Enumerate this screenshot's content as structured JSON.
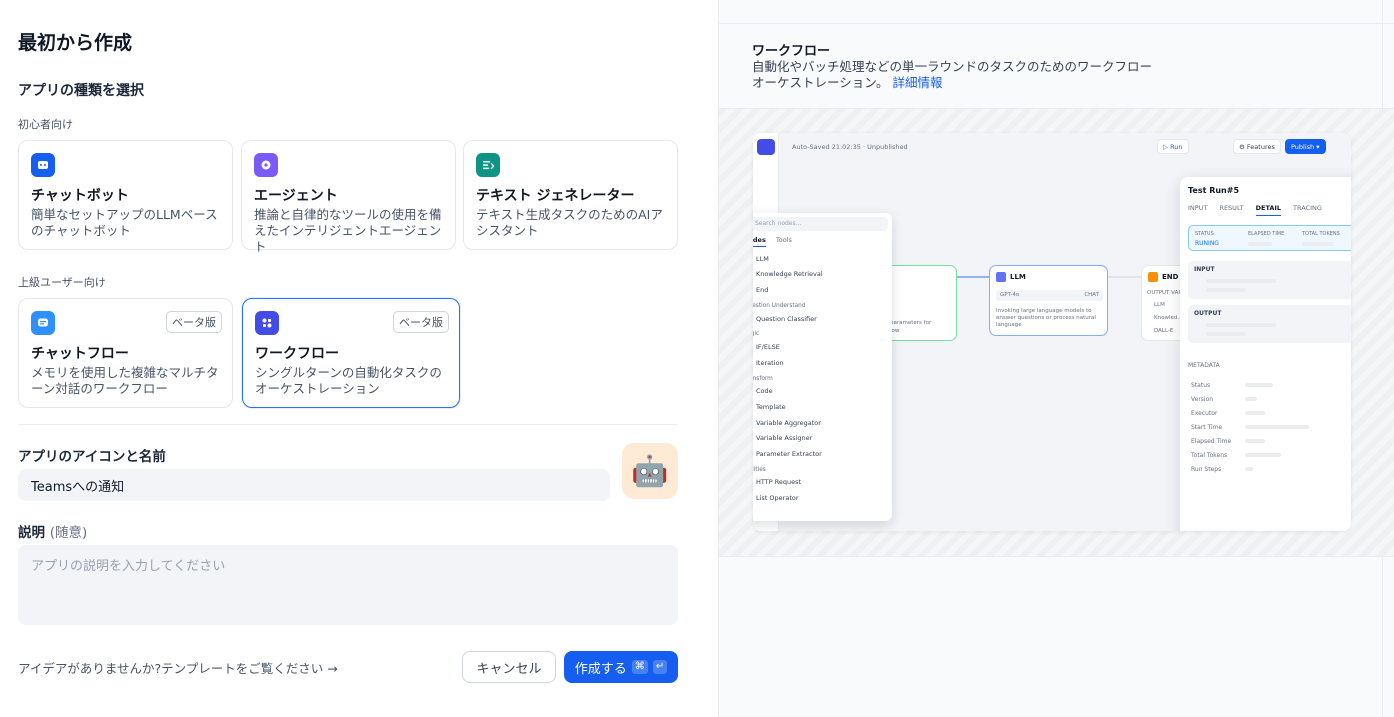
{
  "left": {
    "page_title": "最初から作成",
    "app_type_title": "アプリの種類を選択",
    "beginner_label": "初心者向け",
    "advanced_label": "上級ユーザー向け",
    "beginner_cards": [
      {
        "title": "チャットボット",
        "desc": "簡単なセットアップのLLMベースのチャットボット",
        "icon": "chatbot-icon",
        "color": "#155eef"
      },
      {
        "title": "エージェント",
        "desc": "推論と自律的なツールの使用を備えたインテリジェントエージェント",
        "icon": "agent-icon",
        "color": "#7a5af8"
      },
      {
        "title": "テキスト ジェネレーター",
        "desc": "テキスト生成タスクのためのAIアシスタント",
        "icon": "text-generator-icon",
        "color": "#0e9384"
      }
    ],
    "advanced_cards": [
      {
        "title": "チャットフロー",
        "desc": "メモリを使用した複雑なマルチターン対話のワークフロー",
        "icon": "chatflow-icon",
        "color": "#2e90fa",
        "badge": "ベータ版"
      },
      {
        "title": "ワークフロー",
        "desc": "シングルターンの自動化タスクのオーケストレーション",
        "icon": "workflow-icon",
        "color": "#444ce7",
        "badge": "ベータ版"
      }
    ],
    "name_label": "アプリのアイコンと名前",
    "name_value": "Teamsへの通知",
    "emoji": "🤖",
    "desc_label": "説明",
    "desc_optional": "(随意)",
    "desc_placeholder": "アプリの説明を入力してください",
    "template_link": "アイデアがありませんか?テンプレートをご覧ください →",
    "cancel_label": "キャンセル",
    "create_label": "作成する",
    "create_kbd1": "⌘",
    "create_kbd2": "↵"
  },
  "right": {
    "title": "ワークフロー",
    "desc": "自動化やバッチ処理などの単一ラウンドのタスクのためのワークフローオーケストレーション。",
    "more_link": "詳細情報",
    "preview": {
      "autosave": "Auto-Saved 21:02:35 · Unpublished",
      "run": "Run",
      "features": "Features",
      "publish": "Publish",
      "search_placeholder": "Search nodes...",
      "tabs": [
        "Nodes",
        "Tools"
      ],
      "nodes": [
        {
          "cat": "",
          "items": [
            {
              "n": "LLM",
              "c": "#6172f3"
            },
            {
              "n": "Knowledge Retrieval",
              "c": "#16b364"
            },
            {
              "n": "End",
              "c": "#f79009"
            }
          ]
        },
        {
          "cat": "Question Understand",
          "items": [
            {
              "n": "Question Classifier",
              "c": "#16b364"
            }
          ]
        },
        {
          "cat": "Logic",
          "items": [
            {
              "n": "IF/ELSE",
              "c": "#06aed4"
            },
            {
              "n": "Iteration",
              "c": "#06aed4"
            }
          ]
        },
        {
          "cat": "Transform",
          "items": [
            {
              "n": "Code",
              "c": "#2e90fa"
            },
            {
              "n": "Template",
              "c": "#2e90fa"
            },
            {
              "n": "Variable Aggregator",
              "c": "#2e90fa"
            },
            {
              "n": "Variable Assigner",
              "c": "#2e90fa"
            },
            {
              "n": "Parameter Extractor",
              "c": "#2e90fa"
            }
          ]
        },
        {
          "cat": "Utilities",
          "items": [
            {
              "n": "HTTP Request",
              "c": "#875bf7"
            },
            {
              "n": "List Operator",
              "c": "#875bf7"
            }
          ]
        }
      ],
      "llm_node": {
        "title": "LLM",
        "model": "GPT-4o",
        "mode": "CHAT",
        "desc": "Invoking large language models to answer questions or process natural language"
      },
      "end_node": {
        "title": "END",
        "label": "OUTPUT VARIA...",
        "outputs": [
          "LLM",
          "Knowled...",
          "DALL-E"
        ]
      },
      "param_node": {
        "text1": "parameters for",
        "text2": "low"
      },
      "test_run": {
        "title": "Test Run#5",
        "tabs": [
          "INPUT",
          "RESULT",
          "DETAIL",
          "TRACING"
        ],
        "status_label": "STATUS",
        "status_value": "RUNING",
        "elapsed_label": "ELAPSED TIME",
        "tokens_label": "TOTAL TOKENS",
        "input_label": "INPUT",
        "output_label": "OUTPUT",
        "metadata_label": "METADATA",
        "meta_rows": [
          "Status",
          "Version",
          "Executor",
          "Start Time",
          "Elapsed Time",
          "Total Tokens",
          "Run Steps"
        ]
      }
    }
  }
}
